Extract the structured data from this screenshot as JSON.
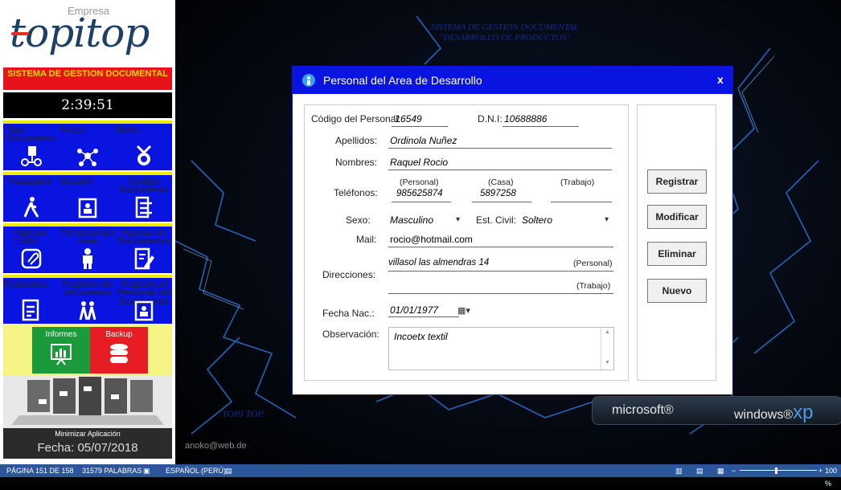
{
  "logo": {
    "company": "Empresa",
    "brand": "topitop"
  },
  "sidebar": {
    "system_title": "SISTEMA DE GESTION DOCUMENTAL",
    "clock": "2:39:51",
    "tiles": [
      {
        "label": "Tipo Documento",
        "icon": "document-flow-icon"
      },
      {
        "label": "Áreas",
        "icon": "network-icon"
      },
      {
        "label": "Roles",
        "icon": "badge-icon"
      },
      {
        "label": "Trabajador",
        "icon": "walking-person-icon"
      },
      {
        "label": "Usuario",
        "icon": "user-card-icon"
      },
      {
        "label": "Codigo Documento",
        "icon": "list-icon"
      },
      {
        "label": "Ingreso Estilo",
        "icon": "paperclip-icon"
      },
      {
        "label": "Personal del Area",
        "icon": "person-icon"
      },
      {
        "label": "Ingreso de Documentos",
        "icon": "edit-document-icon"
      },
      {
        "label": "Requisitos",
        "icon": "checklist-icon"
      },
      {
        "label": "Registro del documento",
        "icon": "group-icon"
      },
      {
        "label": "Registro al Personal del Documento",
        "icon": "user-card-icon"
      }
    ],
    "informes": "Informes",
    "backup": "Backup",
    "minimize": "Minimizar Aplicación",
    "fecha": "Fecha: 05/07/2018"
  },
  "desktop": {
    "title_line1": "SISTEMA DE GESTION DOCUMENTAL",
    "title_line2": "\"DESARROLLO DE PRODUCTOS\"",
    "topitop": "TOPI TOP",
    "anoko": "anoko@web.de",
    "microsoft": "microsoft®",
    "windows": "windows®",
    "xp": "xp"
  },
  "dialog": {
    "title": "Personal del Area de Desarrollo",
    "close": "x",
    "labels": {
      "codigo": "Código del Personal:",
      "dni": "D.N.I:",
      "apellidos": "Apellidos:",
      "nombres": "Nombres:",
      "telefonos": "Teléfonos:",
      "personal": "(Personal)",
      "casa": "(Casa)",
      "trabajo": "(Trabajo)",
      "sexo": "Sexo:",
      "estcivil": "Est. Civil:",
      "mail": "Mail:",
      "direcciones": "Direcciones:",
      "dir_personal": "(Personal)",
      "dir_trabajo": "(Trabajo)",
      "fecha_nac": "Fecha Nac.:",
      "observacion": "Observación:"
    },
    "values": {
      "codigo": "'16549",
      "dni": "10688886",
      "apellidos": "Ordinola Nuñez",
      "nombres": "Raquel Rocio",
      "tel_personal": "985625874",
      "tel_casa": "5897258",
      "tel_trabajo": "",
      "sexo": "Masculino",
      "estcivil": "Soltero",
      "mail": "rocio@hotmail.com",
      "dir_personal": "villasol las almendras 14",
      "dir_trabajo": "",
      "fecha_nac": "01/01/1977",
      "observacion": "Incoetx textil"
    },
    "buttons": {
      "registrar": "Registrar",
      "modificar": "Modificar",
      "eliminar": "Eliminar",
      "nuevo": "Nuevo"
    }
  },
  "statusbar": {
    "page": "PÁGINA 151 DE 158",
    "words": "31579 PALABRAS",
    "lang": "ESPAÑOL (PERÚ)",
    "zoom": "100 %"
  }
}
